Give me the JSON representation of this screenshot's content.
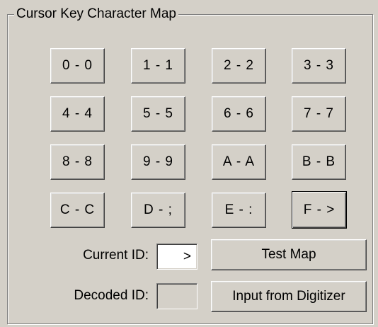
{
  "group": {
    "title": "Cursor Key Character Map"
  },
  "keys": [
    "0 - 0",
    "1 - 1",
    "2 - 2",
    "3 - 3",
    "4 - 4",
    "5 - 5",
    "6 - 6",
    "7 - 7",
    "8 - 8",
    "9 - 9",
    "A - A",
    "B - B",
    "C - C",
    "D - ;",
    "E - :",
    "F - >"
  ],
  "current_id": {
    "label": "Current ID:",
    "value": ">"
  },
  "decoded_id": {
    "label": "Decoded ID:",
    "value": ""
  },
  "buttons": {
    "test_map": "Test Map",
    "input_from_digitizer": "Input from Digitizer"
  }
}
